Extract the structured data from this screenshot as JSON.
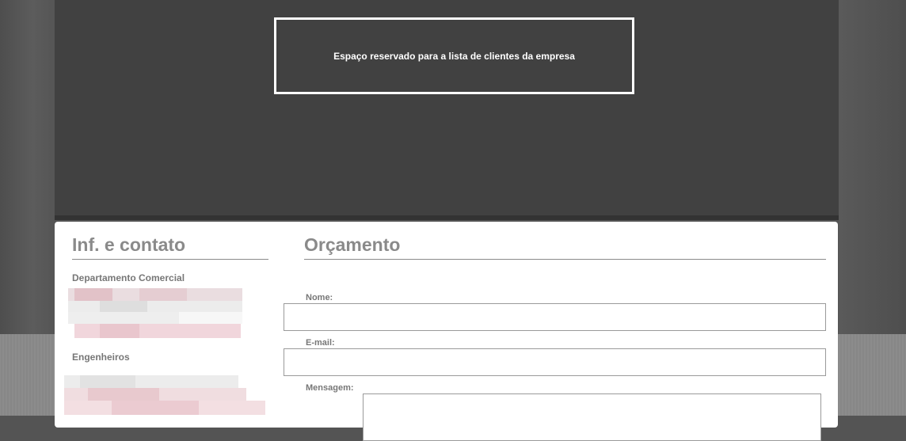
{
  "clients": {
    "placeholder_text": "Espaço reservado para a lista de clientes da empresa"
  },
  "contact": {
    "title": "Inf. e contato",
    "commercial_heading": "Departamento Comercial",
    "engineers_heading": "Engenheiros"
  },
  "quote": {
    "title": "Orçamento",
    "name_label": "Nome:",
    "email_label": "E-mail:",
    "message_label": "Mensagem:"
  },
  "colors": {
    "panel": "#414141",
    "heading": "#8a8a8a",
    "redacted": "#e8c6cb"
  }
}
